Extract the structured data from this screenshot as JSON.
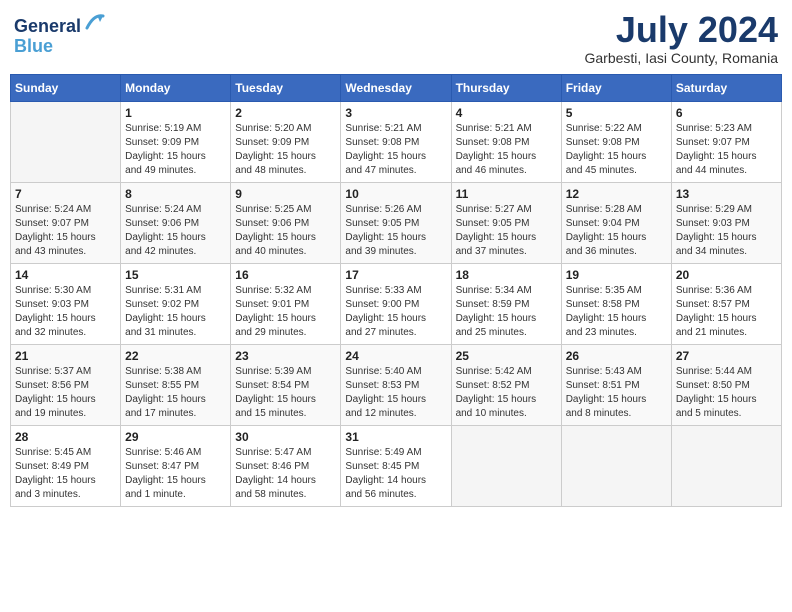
{
  "header": {
    "logo_line1": "General",
    "logo_line2": "Blue",
    "month_title": "July 2024",
    "subtitle": "Garbesti, Iasi County, Romania"
  },
  "calendar": {
    "weekdays": [
      "Sunday",
      "Monday",
      "Tuesday",
      "Wednesday",
      "Thursday",
      "Friday",
      "Saturday"
    ],
    "weeks": [
      [
        {
          "day": "",
          "info": ""
        },
        {
          "day": "1",
          "info": "Sunrise: 5:19 AM\nSunset: 9:09 PM\nDaylight: 15 hours\nand 49 minutes."
        },
        {
          "day": "2",
          "info": "Sunrise: 5:20 AM\nSunset: 9:09 PM\nDaylight: 15 hours\nand 48 minutes."
        },
        {
          "day": "3",
          "info": "Sunrise: 5:21 AM\nSunset: 9:08 PM\nDaylight: 15 hours\nand 47 minutes."
        },
        {
          "day": "4",
          "info": "Sunrise: 5:21 AM\nSunset: 9:08 PM\nDaylight: 15 hours\nand 46 minutes."
        },
        {
          "day": "5",
          "info": "Sunrise: 5:22 AM\nSunset: 9:08 PM\nDaylight: 15 hours\nand 45 minutes."
        },
        {
          "day": "6",
          "info": "Sunrise: 5:23 AM\nSunset: 9:07 PM\nDaylight: 15 hours\nand 44 minutes."
        }
      ],
      [
        {
          "day": "7",
          "info": "Sunrise: 5:24 AM\nSunset: 9:07 PM\nDaylight: 15 hours\nand 43 minutes."
        },
        {
          "day": "8",
          "info": "Sunrise: 5:24 AM\nSunset: 9:06 PM\nDaylight: 15 hours\nand 42 minutes."
        },
        {
          "day": "9",
          "info": "Sunrise: 5:25 AM\nSunset: 9:06 PM\nDaylight: 15 hours\nand 40 minutes."
        },
        {
          "day": "10",
          "info": "Sunrise: 5:26 AM\nSunset: 9:05 PM\nDaylight: 15 hours\nand 39 minutes."
        },
        {
          "day": "11",
          "info": "Sunrise: 5:27 AM\nSunset: 9:05 PM\nDaylight: 15 hours\nand 37 minutes."
        },
        {
          "day": "12",
          "info": "Sunrise: 5:28 AM\nSunset: 9:04 PM\nDaylight: 15 hours\nand 36 minutes."
        },
        {
          "day": "13",
          "info": "Sunrise: 5:29 AM\nSunset: 9:03 PM\nDaylight: 15 hours\nand 34 minutes."
        }
      ],
      [
        {
          "day": "14",
          "info": "Sunrise: 5:30 AM\nSunset: 9:03 PM\nDaylight: 15 hours\nand 32 minutes."
        },
        {
          "day": "15",
          "info": "Sunrise: 5:31 AM\nSunset: 9:02 PM\nDaylight: 15 hours\nand 31 minutes."
        },
        {
          "day": "16",
          "info": "Sunrise: 5:32 AM\nSunset: 9:01 PM\nDaylight: 15 hours\nand 29 minutes."
        },
        {
          "day": "17",
          "info": "Sunrise: 5:33 AM\nSunset: 9:00 PM\nDaylight: 15 hours\nand 27 minutes."
        },
        {
          "day": "18",
          "info": "Sunrise: 5:34 AM\nSunset: 8:59 PM\nDaylight: 15 hours\nand 25 minutes."
        },
        {
          "day": "19",
          "info": "Sunrise: 5:35 AM\nSunset: 8:58 PM\nDaylight: 15 hours\nand 23 minutes."
        },
        {
          "day": "20",
          "info": "Sunrise: 5:36 AM\nSunset: 8:57 PM\nDaylight: 15 hours\nand 21 minutes."
        }
      ],
      [
        {
          "day": "21",
          "info": "Sunrise: 5:37 AM\nSunset: 8:56 PM\nDaylight: 15 hours\nand 19 minutes."
        },
        {
          "day": "22",
          "info": "Sunrise: 5:38 AM\nSunset: 8:55 PM\nDaylight: 15 hours\nand 17 minutes."
        },
        {
          "day": "23",
          "info": "Sunrise: 5:39 AM\nSunset: 8:54 PM\nDaylight: 15 hours\nand 15 minutes."
        },
        {
          "day": "24",
          "info": "Sunrise: 5:40 AM\nSunset: 8:53 PM\nDaylight: 15 hours\nand 12 minutes."
        },
        {
          "day": "25",
          "info": "Sunrise: 5:42 AM\nSunset: 8:52 PM\nDaylight: 15 hours\nand 10 minutes."
        },
        {
          "day": "26",
          "info": "Sunrise: 5:43 AM\nSunset: 8:51 PM\nDaylight: 15 hours\nand 8 minutes."
        },
        {
          "day": "27",
          "info": "Sunrise: 5:44 AM\nSunset: 8:50 PM\nDaylight: 15 hours\nand 5 minutes."
        }
      ],
      [
        {
          "day": "28",
          "info": "Sunrise: 5:45 AM\nSunset: 8:49 PM\nDaylight: 15 hours\nand 3 minutes."
        },
        {
          "day": "29",
          "info": "Sunrise: 5:46 AM\nSunset: 8:47 PM\nDaylight: 15 hours\nand 1 minute."
        },
        {
          "day": "30",
          "info": "Sunrise: 5:47 AM\nSunset: 8:46 PM\nDaylight: 14 hours\nand 58 minutes."
        },
        {
          "day": "31",
          "info": "Sunrise: 5:49 AM\nSunset: 8:45 PM\nDaylight: 14 hours\nand 56 minutes."
        },
        {
          "day": "",
          "info": ""
        },
        {
          "day": "",
          "info": ""
        },
        {
          "day": "",
          "info": ""
        }
      ]
    ]
  }
}
